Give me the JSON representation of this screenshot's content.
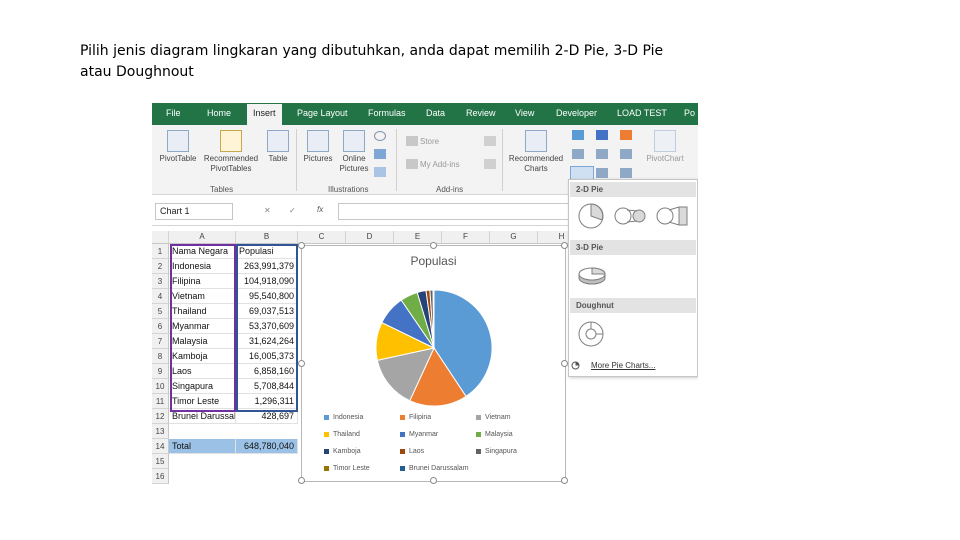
{
  "caption": [
    "Pilih jenis diagram lingkaran yang dibutuhkan, anda dapat memilih 2-D Pie, 3-D Pie",
    "atau Doughnout"
  ],
  "ribbon_tabs": [
    "File",
    "Home",
    "Insert",
    "Page Layout",
    "Formulas",
    "Data",
    "Review",
    "View",
    "Developer",
    "LOAD TEST",
    "Po"
  ],
  "ribbon": {
    "pivottable": [
      "PivotTable"
    ],
    "recommended_pivot": [
      "Recommended",
      "PivotTables"
    ],
    "table": [
      "Table"
    ],
    "pictures": [
      "Pictures"
    ],
    "online_pictures": [
      "Online",
      "Pictures"
    ],
    "store": "Store",
    "my_addins": "My Add-ins",
    "recommended_charts": [
      "Recommended",
      "Charts"
    ],
    "pivotchart": "PivotChart",
    "group_tables": "Tables",
    "group_illustrations": "Illustrations",
    "group_addins": "Add-ins"
  },
  "formula_bar": {
    "name_box": "Chart 1",
    "fx": "fx",
    "cancel": "✕",
    "enter": "✓"
  },
  "columns": [
    "A",
    "B",
    "C",
    "D",
    "E",
    "F",
    "G",
    "H"
  ],
  "rows": [
    "1",
    "2",
    "3",
    "4",
    "5",
    "6",
    "7",
    "8",
    "9",
    "10",
    "11",
    "12",
    "13",
    "14",
    "15",
    "16"
  ],
  "table": {
    "header": [
      "Nama Negara",
      "Populasi"
    ],
    "rows": [
      [
        "Indonesia",
        "263,991,379"
      ],
      [
        "Filipina",
        "104,918,090"
      ],
      [
        "Vietnam",
        "95,540,800"
      ],
      [
        "Thailand",
        "69,037,513"
      ],
      [
        "Myanmar",
        "53,370,609"
      ],
      [
        "Malaysia",
        "31,624,264"
      ],
      [
        "Kamboja",
        "16,005,373"
      ],
      [
        "Laos",
        "6,858,160"
      ],
      [
        "Singapura",
        "5,708,844"
      ],
      [
        "Timor Leste",
        "1,296,311"
      ],
      [
        "Brunei Darussalam",
        "428,697"
      ]
    ],
    "total": [
      "Total",
      "648,780,040"
    ]
  },
  "chart": {
    "title": "Populasi",
    "legend": [
      "Indonesia",
      "Filipina",
      "Vietnam",
      "Thailand",
      "Myanmar",
      "Malaysia",
      "Kamboja",
      "Laos",
      "Singapura",
      "Timor Leste",
      "Brunei Darussalam"
    ],
    "colors": [
      "#5b9bd5",
      "#ed7d31",
      "#a5a5a5",
      "#ffc000",
      "#4472c4",
      "#70ad47",
      "#264478",
      "#9e480e",
      "#636363",
      "#997300",
      "#255e91"
    ]
  },
  "chart_data": {
    "type": "pie",
    "title": "Populasi",
    "categories": [
      "Indonesia",
      "Filipina",
      "Vietnam",
      "Thailand",
      "Myanmar",
      "Malaysia",
      "Kamboja",
      "Laos",
      "Singapura",
      "Timor Leste",
      "Brunei Darussalam"
    ],
    "values": [
      263991379,
      104918090,
      95540800,
      69037513,
      53370609,
      31624264,
      16005373,
      6858160,
      5708844,
      1296311,
      428697
    ],
    "legend": "bottom"
  },
  "dropdown": {
    "pie2d": "2-D Pie",
    "pie3d": "3-D Pie",
    "doughnut": "Doughnut",
    "more": "More Pie Charts..."
  }
}
